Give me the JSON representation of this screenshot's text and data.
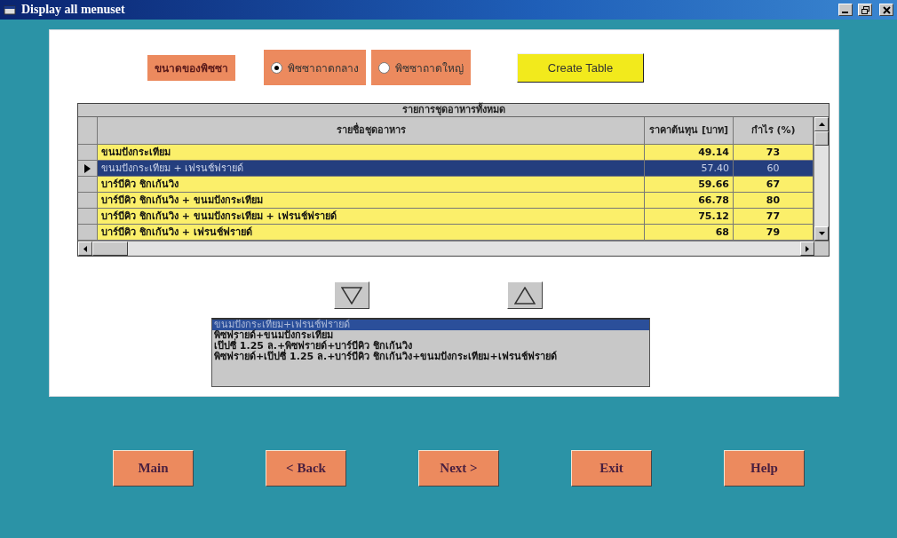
{
  "window": {
    "title": "Display all menuset"
  },
  "size_label": "ขนาดของพิซซา",
  "size_options": [
    {
      "label": "พิซซาถาดกลาง",
      "selected": true
    },
    {
      "label": "พิซซาถาดใหญ่",
      "selected": false
    }
  ],
  "create_button": "Create Table",
  "table": {
    "caption": "รายการชุดอาหารทั้งหมด",
    "columns": [
      "รายชื่อชุดอาหาร",
      "ราคาต้นทุน [บาท]",
      "กำไร (%)"
    ],
    "rows": [
      {
        "cells": [
          "ขนมปังกระเทียม",
          "49.14",
          "73"
        ],
        "selected": false
      },
      {
        "cells": [
          "ขนมปังกระเทียม + เฟรนช์ฟรายด์",
          "57.40",
          "60"
        ],
        "selected": true
      },
      {
        "cells": [
          "บาร์บีคิว ชิกเก้นวิง",
          "59.66",
          "67"
        ],
        "selected": false
      },
      {
        "cells": [
          "บาร์บีคิว ชิกเก้นวิง + ขนมปังกระเทียม",
          "66.78",
          "80"
        ],
        "selected": false
      },
      {
        "cells": [
          "บาร์บีคิว ชิกเก้นวิง + ขนมปังกระเทียม + เฟรนช์ฟรายด์",
          "75.12",
          "77"
        ],
        "selected": false
      },
      {
        "cells": [
          "บาร์บีคิว ชิกเก้นวิง + เฟรนช์ฟรายด์",
          "68",
          "79"
        ],
        "selected": false
      }
    ]
  },
  "selection_list": [
    {
      "label": "ขนมปังกระเทียม+เฟรนช์ฟรายด์",
      "selected": true
    },
    {
      "label": "พิซฟรายด์+ขนมปังกระเทียม",
      "selected": false
    },
    {
      "label": "เป๊ปซี่ 1.25 ล.+พิซฟรายด์+บาร์บีคิว ชิกเก้นวิง",
      "selected": false
    },
    {
      "label": "พิซฟรายด์+เป๊ปซี่ 1.25 ล.+บาร์บีคิว ชิกเก้นวิง+ขนมปังกระเทียม+เฟรนช์ฟรายด์",
      "selected": false
    }
  ],
  "nav_buttons": [
    "Main",
    "< Back",
    "Next >",
    "Exit",
    "Help"
  ]
}
